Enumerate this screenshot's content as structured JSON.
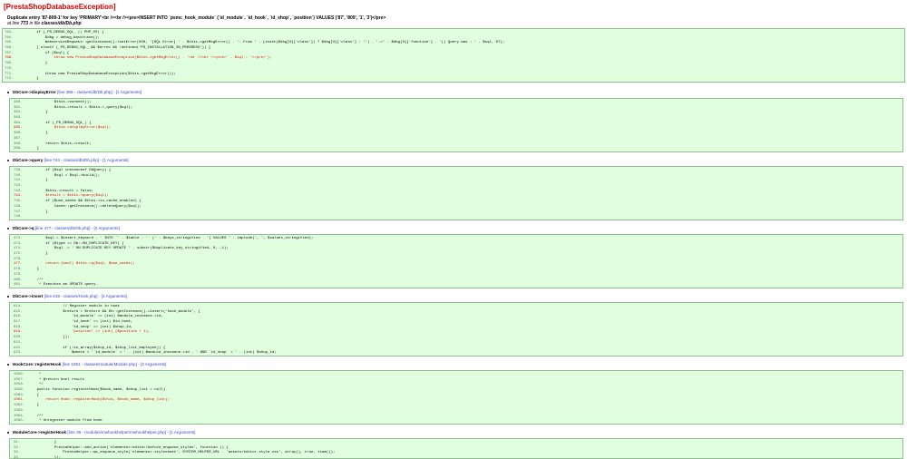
{
  "exception": {
    "title": "[PrestaShopDatabaseException]",
    "message": "Duplicate entry '87-809-1' for key 'PRIMARY'<br /><br /><pre>INSERT INTO `psmc_hook_module` (`id_module`, `id_hook`, `id_shop`, `position`) VALUES ('87', '809', '1', '3')</pre>",
    "location_prefix": "at line",
    "location_line": "773",
    "location_mid": "in file",
    "location_file": "classes/db/Db.php"
  },
  "main_code": [
    {
      "n": "763.",
      "t": "        if (_PS_DEBUG_SQL_ || PHP_OS) {",
      "hl": false
    },
    {
      "n": "764.",
      "t": "            $dbg = debug_backtrace();",
      "hl": false
    },
    {
      "n": "765.",
      "t": "            WebserviceRequest::getInstance()->setError(500, '[SQL Error] ' . $this->getMsgError() . '. From ' . (isset($dbg[3]['class']) ? $dbg[3]['class'] : '') . '->' . $dbg[3]['function'] . '() Query was : ' . $sql, 97);",
      "hl": false
    },
    {
      "n": "766.",
      "t": "        } elseif (_PS_DEBUG_SQL_ && $errno && !defined('PS_INSTALLATION_IN_PROGRESS')) {",
      "hl": false
    },
    {
      "n": "767.",
      "t": "            if ($sql) {",
      "hl": false
    },
    {
      "n": "768.",
      "t": "                throw new PrestaShopDatabaseException($this->getMsgError() . '<br /><br /><pre>' . $sql . '</pre>');",
      "hl": true
    },
    {
      "n": "769.",
      "t": "            }",
      "hl": false
    },
    {
      "n": "770.",
      "t": "",
      "hl": false
    },
    {
      "n": "771.",
      "t": "            throw new PrestaShopDatabaseException($this->getMsgError());",
      "hl": false
    },
    {
      "n": "772.",
      "t": "        }",
      "hl": false
    },
    {
      "n": "773.",
      "t": "    }",
      "hl": false
    }
  ],
  "frames": [
    {
      "fn": "DbCore->displayError",
      "meta": "[line 385 - classes/db/Db.php] - [1 Arguments]",
      "lines": [
        {
          "n": "380.",
          "t": "            $this->connect();",
          "hl": false
        },
        {
          "n": "381.",
          "t": "            $this->result = $this->_query($sql);",
          "hl": false
        },
        {
          "n": "382.",
          "t": "        }",
          "hl": false
        },
        {
          "n": "383.",
          "t": "",
          "hl": false
        },
        {
          "n": "384.",
          "t": "        if (_PS_DEBUG_SQL_) {",
          "hl": false
        },
        {
          "n": "385.",
          "t": "            $this->displayError($sql);",
          "hl": true
        },
        {
          "n": "386.",
          "t": "        }",
          "hl": false
        },
        {
          "n": "387.",
          "t": "",
          "hl": false
        },
        {
          "n": "388.",
          "t": "        return $this->result;",
          "hl": false
        },
        {
          "n": "389.",
          "t": "    }",
          "hl": false
        },
        {
          "n": "390.",
          "t": "",
          "hl": false
        }
      ]
    },
    {
      "fn": "DbCore->query",
      "meta": "[line 744 - classes/db/Db.php] - [1 Arguments]",
      "lines": [
        {
          "n": "739.",
          "t": "        if ($sql instanceof DbQuery) {",
          "hl": false
        },
        {
          "n": "740.",
          "t": "            $sql = $sql->build();",
          "hl": false
        },
        {
          "n": "741.",
          "t": "        }",
          "hl": false
        },
        {
          "n": "742.",
          "t": "",
          "hl": false
        },
        {
          "n": "743.",
          "t": "        $this->result = false;",
          "hl": false
        },
        {
          "n": "744.",
          "t": "        $result = $this->query($sql);",
          "hl": true
        },
        {
          "n": "745.",
          "t": "        if ($use_cache && $this->is_cache_enabled) {",
          "hl": false
        },
        {
          "n": "746.",
          "t": "            Cache::getInstance()->deleteQuery($sql);",
          "hl": false
        },
        {
          "n": "747.",
          "t": "        }",
          "hl": false
        },
        {
          "n": "748.",
          "t": "",
          "hl": false
        },
        {
          "n": "749.",
          "t": "        if (_PS_DEBUG_SQL_) {",
          "hl": false
        }
      ]
    },
    {
      "fn": "DbCore->q",
      "meta": "[line 477 - classes/db/Db.php] - [2 Arguments]",
      "lines": [
        {
          "n": "472.",
          "t": "        $sql = $insert_keyword . ' INTO `' . $table . '` (' . $keys_stringified . ') VALUES ' . implode(', ', $values_stringified);",
          "hl": false
        },
        {
          "n": "473.",
          "t": "        if ($type == Db::ON_DUPLICATE_KEY) {",
          "hl": false
        },
        {
          "n": "474.",
          "t": "            $sql .= ' ON DUPLICATE KEY UPDATE ' . substr($duplicate_key_stringified, 0, -1);",
          "hl": false
        },
        {
          "n": "475.",
          "t": "        }",
          "hl": false
        },
        {
          "n": "476.",
          "t": "",
          "hl": false
        },
        {
          "n": "477.",
          "t": "        return (bool) $this->q($sql, $use_cache);",
          "hl": true
        },
        {
          "n": "478.",
          "t": "    }",
          "hl": false
        },
        {
          "n": "479.",
          "t": "",
          "hl": false
        },
        {
          "n": "480.",
          "t": "    /**",
          "hl": false
        },
        {
          "n": "481.",
          "t": "     * Executes an UPDATE query.",
          "hl": false
        },
        {
          "n": "482.",
          "t": "     *",
          "hl": false
        }
      ]
    },
    {
      "fn": "DbCore->insert",
      "meta": "[line 619 - classes/Hook.php] - [2 Arguments]",
      "lines": [
        {
          "n": "614.",
          "t": "                // Register module in hook",
          "hl": false
        },
        {
          "n": "615.",
          "t": "                $return = $return && Db::getInstance()->insert('hook_module', [",
          "hl": false
        },
        {
          "n": "616.",
          "t": "                    'id_module' => (int) $module_instance->id,",
          "hl": false
        },
        {
          "n": "617.",
          "t": "                    'id_hook' => (int) $id_hook,",
          "hl": false
        },
        {
          "n": "618.",
          "t": "                    'id_shop' => (int) $shop_id,",
          "hl": false
        },
        {
          "n": "619.",
          "t": "                    'position' => (int) ($position + 1),",
          "hl": true
        },
        {
          "n": "620.",
          "t": "                ]);",
          "hl": false
        },
        {
          "n": "621.",
          "t": "",
          "hl": false
        },
        {
          "n": "622.",
          "t": "                if (!in_array($shop_id, $shop_list_employee)) {",
          "hl": false
        },
        {
          "n": "623.",
          "t": "                    $where = '`id_module` = ' . (int) $module_instance->id . ' AND `id_shop` = ' . (int) $shop_id;",
          "hl": false
        },
        {
          "n": "624.",
          "t": "                    $return = $return && Db::getInstance()->delete('module_shop', $where);",
          "hl": false
        }
      ]
    },
    {
      "fn": "HookCore::registerHook",
      "meta": "[line 1081 - classes/module/Module.php] - [3 Arguments]",
      "lines": [
        {
          "n": "1056.",
          "t": "     *",
          "hl": false
        },
        {
          "n": "1057.",
          "t": "     * @return bool result",
          "hl": false
        },
        {
          "n": "1058.",
          "t": "     */",
          "hl": false
        },
        {
          "n": "1059.",
          "t": "    public function registerHook($hook_name, $shop_list = null)",
          "hl": false
        },
        {
          "n": "1060.",
          "t": "    {",
          "hl": false
        },
        {
          "n": "1061.",
          "t": "        return Hook::registerHook($this, $hook_name, $shop_list);",
          "hl": true
        },
        {
          "n": "1062.",
          "t": "    }",
          "hl": false
        },
        {
          "n": "1063.",
          "t": "",
          "hl": false
        },
        {
          "n": "1064.",
          "t": "    /**",
          "hl": false
        },
        {
          "n": "1065.",
          "t": "     * Unregister module from hook",
          "hl": false
        },
        {
          "n": "1066.",
          "t": "     *",
          "hl": false
        }
      ]
    },
    {
      "fn": "ModuleCore->registerHook",
      "meta": "[line 36 - modules/mwhookhelper/mwhookhelper.php] - [1 Arguments]",
      "lines": [
        {
          "n": "31.",
          "t": "            }",
          "hl": false
        },
        {
          "n": "32.",
          "t": "            PrestaHelper::add_action('elementor/editor/before_enqueue_styles', function () {",
          "hl": false
        },
        {
          "n": "33.",
          "t": "                PrestaHelper::wp_enqueue_style('elementor-stylesheet', SYSTEM_HELPER_URL . 'assets/editor-style.css', array(), true, time());",
          "hl": false
        },
        {
          "n": "34.",
          "t": "            });",
          "hl": false
        }
      ]
    }
  ]
}
